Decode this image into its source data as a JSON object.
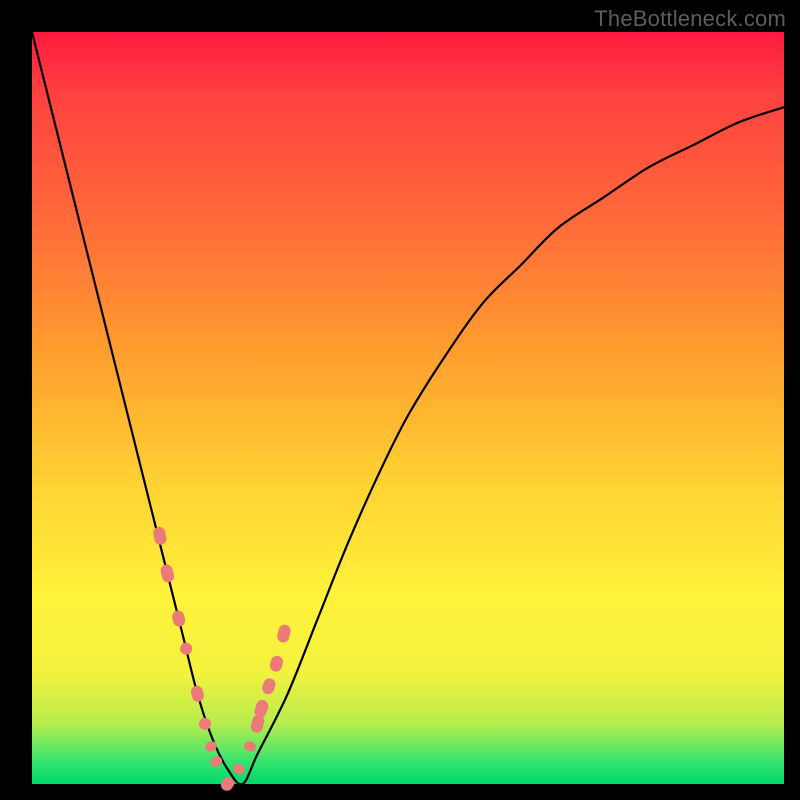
{
  "watermark": "TheBottleneck.com",
  "chart_data": {
    "type": "line",
    "title": "",
    "xlabel": "",
    "ylabel": "",
    "xlim": [
      0,
      100
    ],
    "ylim": [
      0,
      100
    ],
    "grid": false,
    "background_gradient": [
      "#ff1a40",
      "#ff9c2e",
      "#fff23a",
      "#00d96b"
    ],
    "series": [
      {
        "name": "bottleneck-curve",
        "x": [
          0,
          2,
          4,
          6,
          8,
          10,
          12,
          14,
          16,
          18,
          20,
          22,
          24,
          26,
          28,
          30,
          34,
          38,
          42,
          46,
          50,
          55,
          60,
          65,
          70,
          76,
          82,
          88,
          94,
          100
        ],
        "values": [
          100,
          92,
          84,
          76,
          68,
          60,
          52,
          44,
          36,
          28,
          20,
          12,
          6,
          2,
          0,
          4,
          12,
          22,
          32,
          41,
          49,
          57,
          64,
          69,
          74,
          78,
          82,
          85,
          88,
          90
        ]
      }
    ],
    "markers": {
      "name": "highlighted-points",
      "color": "#eb7a78",
      "x": [
        17,
        18,
        19.5,
        20.5,
        22,
        23,
        23.8,
        24.5,
        26,
        27.5,
        29,
        30,
        30.5,
        31.5,
        32.5,
        33.5
      ],
      "values": [
        33,
        28,
        22,
        18,
        12,
        8,
        5,
        3,
        0,
        2,
        5,
        8,
        10,
        13,
        16,
        20
      ],
      "sizes": [
        18,
        18,
        16,
        12,
        16,
        12,
        10,
        10,
        14,
        10,
        10,
        18,
        18,
        16,
        16,
        18
      ]
    }
  }
}
